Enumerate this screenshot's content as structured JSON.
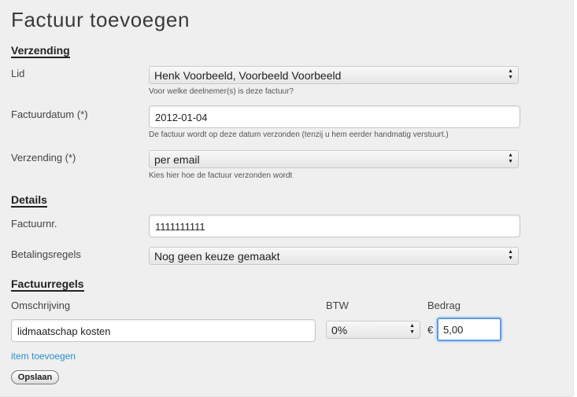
{
  "page": {
    "title": "Factuur toevoegen"
  },
  "sections": {
    "verzending": "Verzending",
    "details": "Details",
    "factuurregels": "Factuurregels"
  },
  "fields": {
    "lid": {
      "label": "Lid",
      "value": "Henk Voorbeeld, Voorbeeld Voorbeeld",
      "help": "Voor welke deelnemer(s) is deze factuur?"
    },
    "factuurdatum": {
      "label": "Factuurdatum (*)",
      "value": "2012-01-04",
      "help": "De factuur wordt op deze datum verzonden (tenzij u hem eerder handmatig verstuurt.)"
    },
    "verzending": {
      "label": "Verzending (*)",
      "value": "per email",
      "help": "Kies hier hoe de factuur verzonden wordt"
    },
    "factuurnr": {
      "label": "Factuurnr.",
      "value": "1111111111"
    },
    "betalingsregels": {
      "label": "Betalingsregels",
      "value": "Nog geen keuze gemaakt"
    }
  },
  "lines": {
    "headers": {
      "description": "Omschrijving",
      "vat": "BTW",
      "amount": "Bedrag"
    },
    "rows": [
      {
        "description": "lidmaatschap kosten",
        "vat": "0%",
        "currency": "€",
        "amount": "5,00"
      }
    ]
  },
  "actions": {
    "add_item": "item toevoegen",
    "save": "Opslaan"
  }
}
